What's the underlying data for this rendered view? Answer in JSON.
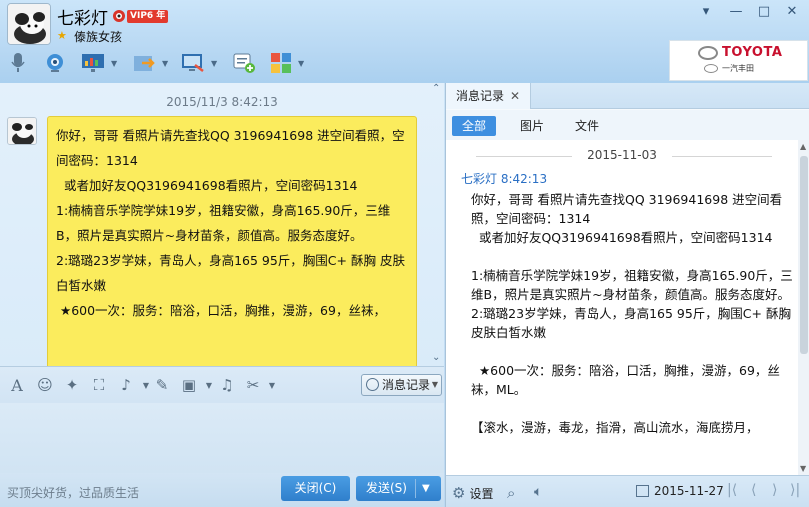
{
  "contact": {
    "name": "七彩灯",
    "vip_label": "VIP6 年",
    "signature": "傣族女孩"
  },
  "window": {
    "minimize": "▾",
    "restore": "▭",
    "maximize": "□",
    "close": "✕"
  },
  "ad": {
    "brand": "TOYOTA",
    "sub": "一汽丰田"
  },
  "toolbar": {
    "icons": [
      "microphone-icon",
      "video-icon",
      "screen-share-icon",
      "file-transfer-icon",
      "remote-desktop-icon",
      "new-note-icon",
      "apps-icon"
    ]
  },
  "chat": {
    "timestamp": "2015/11/3 8:42:13",
    "message_lines": [
      "你好，哥哥 看照片请先查找QQ 3196941698 进空间看照，空间密码：1314",
      "  或者加好友QQ3196941698看照片，空间密码1314",
      "",
      "1:楠楠音乐学院学妹19岁，祖籍安徽，身高165.90斤，三维B，照片是真实照片~身材苗条，颜值高。服务态度好。",
      "2:璐璐23岁学妹，青岛人，身高165 95斤，胸围C+ 酥胸 皮肤白皙水嫩",
      "",
      " ★600一次：服务：陪浴，口活，胸推，漫游，69，丝袜，"
    ]
  },
  "input_toolbar": {
    "history_label": "消息记录"
  },
  "bottom": {
    "ad_text": "买顶尖好货，过品质生活",
    "close_label": "关闭(C)",
    "send_label": "发送(S)"
  },
  "history": {
    "tab_label": "消息记录",
    "filters": [
      "全部",
      "图片",
      "文件"
    ],
    "date": "2015-11-03",
    "sender_line": "七彩灯  8:42:13",
    "message": "你好，哥哥 看照片请先查找QQ 3196941698 进空间看照，空间密码：1314\n  或者加好友QQ3196941698看照片，空间密码1314\n\n1:楠楠音乐学院学妹19岁，祖籍安徽，身高165.90斤，三维B，照片是真实照片~身材苗条，颜值高。服务态度好。\n2:璐璐23岁学妹，青岛人，身高165 95斤，胸围C+ 酥胸 皮肤白皙水嫩\n\n  ★600一次：服务：陪浴，口活，胸推，漫游，69，丝袜，ML。\n\n【滚水，漫游，毒龙，指滑，高山流水，海底捞月，",
    "footer": {
      "settings_label": "设置",
      "date_label": "2015-11-27"
    }
  },
  "colors": {
    "accent": "#3e8fe0",
    "bubble": "#fbec5d",
    "sender": "#2a6fc4"
  }
}
